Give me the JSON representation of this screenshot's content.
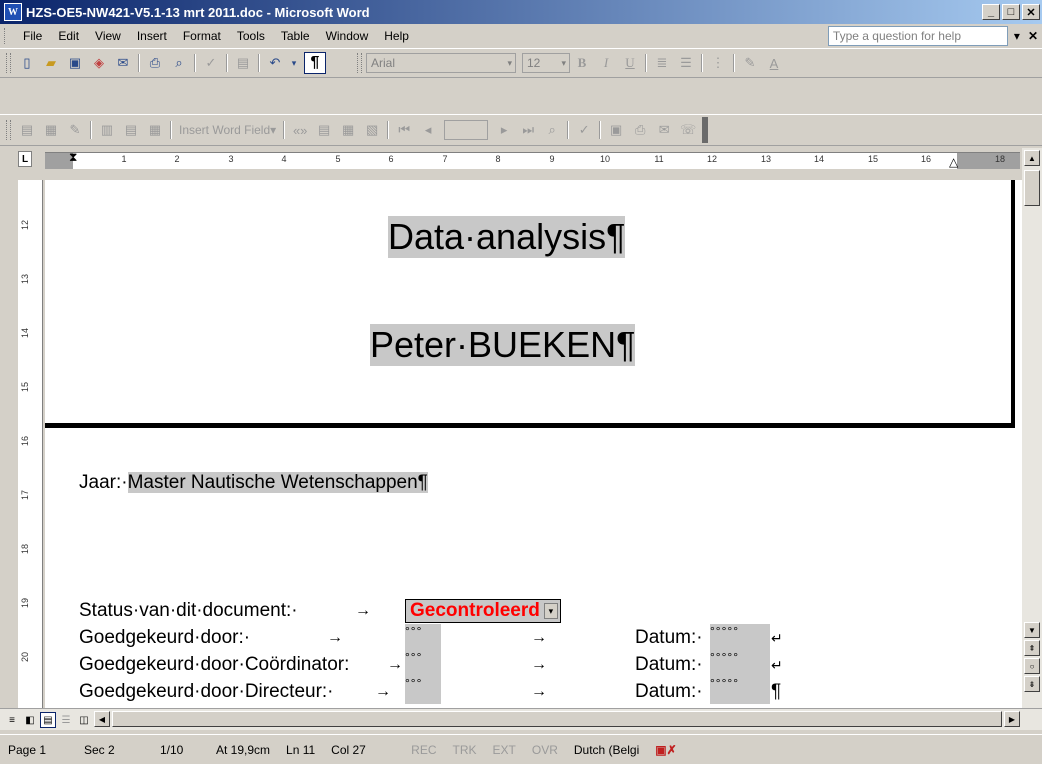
{
  "window": {
    "title": "HZS-OE5-NW421-V5.1-13 mrt 2011.doc - Microsoft Word",
    "app_icon": "W",
    "minimize": "_",
    "maximize": "□",
    "close": "✕"
  },
  "menu": {
    "items": [
      "File",
      "Edit",
      "View",
      "Insert",
      "Format",
      "Tools",
      "Table",
      "Window",
      "Help"
    ],
    "help_placeholder": "Type a question for help",
    "help_arrow": "▾",
    "close_doc": "✕"
  },
  "formatting": {
    "font": "Arial",
    "size": "12",
    "show_marks": "¶"
  },
  "mail_merge": {
    "insert_word_field": "Insert Word Field",
    "record": ""
  },
  "ruler": {
    "tab_selector": "L",
    "numbers": [
      "1",
      "2",
      "3",
      "4",
      "5",
      "6",
      "7",
      "8",
      "9",
      "10",
      "11",
      "12",
      "13",
      "14",
      "15",
      "16",
      "18"
    ],
    "vertical_numbers": [
      "12",
      "13",
      "14",
      "15",
      "16",
      "17",
      "18",
      "19",
      "20"
    ]
  },
  "document": {
    "title": "Data·analysis¶",
    "author": "Peter·BUEKEN¶",
    "year_label": "Jaar:·",
    "year_value": "Master Nautische Wetenschappen¶",
    "status_label": "Status·van·dit·document:·",
    "status_value": "Gecontroleerd",
    "approved_by": "Goedgekeurd·door:·",
    "approved_coord": "Goedgekeurd·door·Coördinator:",
    "approved_dir": "Goedgekeurd·door·Directeur:·",
    "date_label": "Datum:·",
    "tab_arrow": "→",
    "field_dots_short": "°°°",
    "field_dots_long": "°°°°°",
    "line_break": "↵",
    "pilcrow": "¶"
  },
  "statusbar": {
    "page": "Page 1",
    "sec": "Sec 2",
    "pages": "1/10",
    "at": "At 19,9cm",
    "ln": "Ln 11",
    "col": "Col 27",
    "rec": "REC",
    "trk": "TRK",
    "ext": "EXT",
    "ovr": "OVR",
    "lang": "Dutch (Belgi"
  }
}
